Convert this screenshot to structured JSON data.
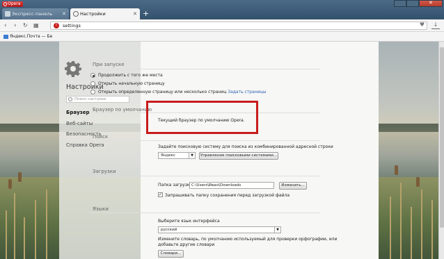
{
  "browser": {
    "menu_label": "Opera",
    "tabs": [
      {
        "label": "Экспресс-панель"
      },
      {
        "label": "Настройки"
      }
    ],
    "new_tab_symbol": "+",
    "address": "settings",
    "bookmark": "Яндекс.Почта — Бе"
  },
  "sidebar": {
    "title": "Настройки",
    "search_placeholder": "Поиск настроек",
    "items": [
      {
        "label": "Браузер",
        "active": true
      },
      {
        "label": "Веб-сайты",
        "active": false
      },
      {
        "label": "Безопасность",
        "active": false
      },
      {
        "label": "Справка Opera",
        "active": false
      }
    ]
  },
  "startup": {
    "title": "При запуске",
    "options": [
      {
        "label": "Продолжить с того же места",
        "selected": true
      },
      {
        "label": "Открыть начальную страницу",
        "selected": false
      },
      {
        "label": "Открыть определенную страницу или несколько страниц",
        "selected": false
      }
    ],
    "set_pages_link": "Задать страницы"
  },
  "default_browser": {
    "title": "Браузер по умолчанию",
    "status": "Текущий браузер по умолчанию Opera."
  },
  "search": {
    "title": "Поиск",
    "description": "Задайте поисковую систему для поиска из комбинированной адресной строки",
    "engine": "Яндекс",
    "manage_button": "Управление поисковыми системами..."
  },
  "downloads": {
    "title": "Загрузки",
    "folder_label": "Папка загрузки:",
    "folder_value": "C:\\Users\\Иван\\Downloads",
    "change_button": "Изменить...",
    "ask_label": "Запрашивать папку сохранения перед загрузкой файла",
    "ask_checked": true
  },
  "languages": {
    "title": "Языки",
    "choose_label": "Выберите язык интерфейса",
    "language": "русский",
    "dictionary_text": "Измените словарь, по умолчанию используемый для проверки орфографии, или добавьте другие словари",
    "dictionaries_button": "Словари..."
  },
  "colors": {
    "highlight": "#c81c1c",
    "link": "#2a62b8"
  }
}
